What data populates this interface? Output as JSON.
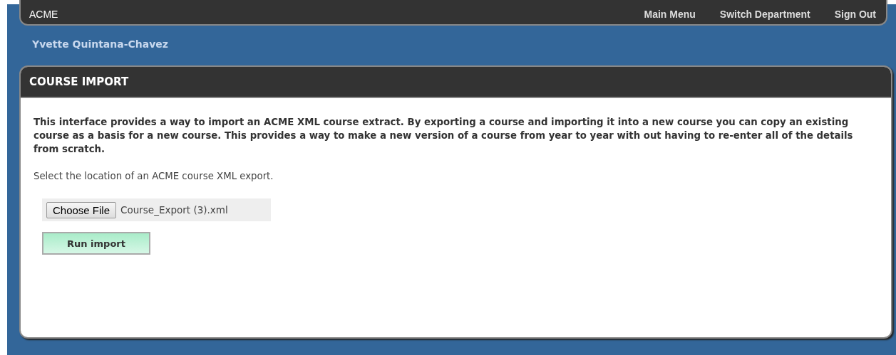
{
  "top_bar": {
    "brand": "ACME",
    "links": [
      "Main Menu",
      "Switch Department",
      "Sign Out"
    ]
  },
  "user_name": "Yvette Quintana-Chavez",
  "panel": {
    "title": "COURSE IMPORT",
    "intro": "This interface provides a way to import an ACME XML course extract. By exporting a course and importing it into a new course you can copy an existing course as a basis for a new course. This provides a way to make a new version of a course from year to year with out having to re-enter all of the details from scratch.",
    "instruction": "Select the location of an ACME course XML export.",
    "file_picker": {
      "button": "Choose File",
      "file_name": "Course_Export (3).xml"
    },
    "submit": "Run import"
  }
}
